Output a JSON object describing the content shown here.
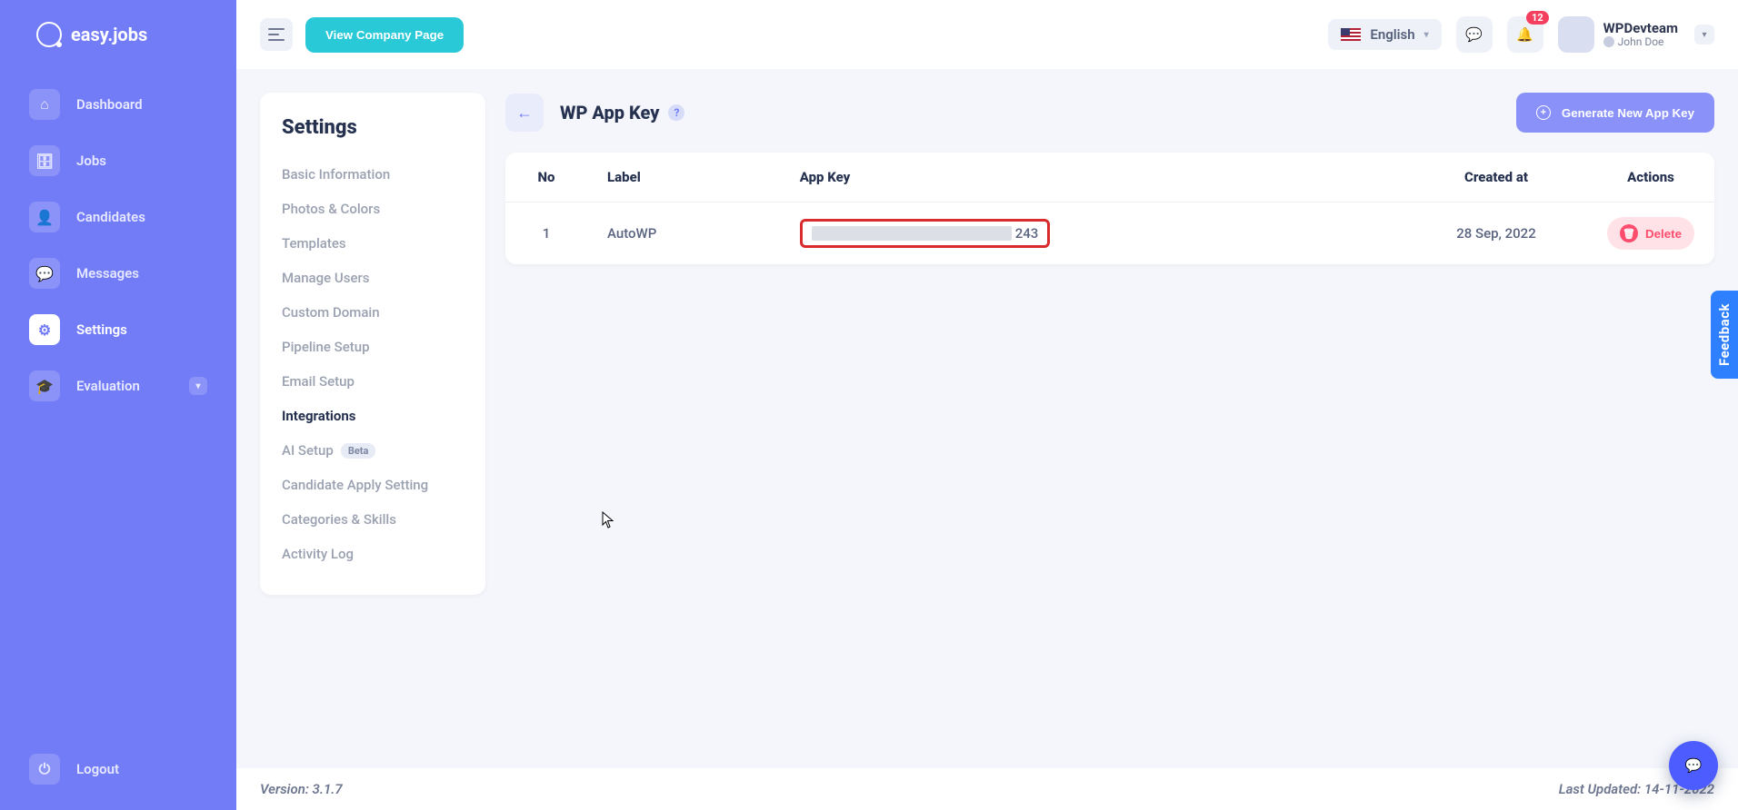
{
  "brand": "easy.jobs",
  "topbar": {
    "view_company": "View Company Page",
    "language": "English",
    "badge": "12",
    "company": "WPDevteam",
    "user": "John Doe"
  },
  "sidebar": {
    "items": [
      {
        "icon": "home",
        "label": "Dashboard"
      },
      {
        "icon": "briefcase",
        "label": "Jobs"
      },
      {
        "icon": "user",
        "label": "Candidates"
      },
      {
        "icon": "chat",
        "label": "Messages"
      },
      {
        "icon": "gear",
        "label": "Settings"
      },
      {
        "icon": "cap",
        "label": "Evaluation"
      }
    ],
    "logout": "Logout"
  },
  "settings": {
    "title": "Settings",
    "items": [
      "Basic Information",
      "Photos & Colors",
      "Templates",
      "Manage Users",
      "Custom Domain",
      "Pipeline Setup",
      "Email Setup",
      "Integrations",
      "AI Setup",
      "Candidate Apply Setting",
      "Categories & Skills",
      "Activity Log"
    ],
    "beta": "Beta"
  },
  "page": {
    "title": "WP App Key",
    "generate": "Generate New App Key",
    "columns": [
      "No",
      "Label",
      "App Key",
      "Created at",
      "Actions"
    ],
    "rows": [
      {
        "no": "1",
        "label": "AutoWP",
        "key_tail": "243",
        "created": "28 Sep, 2022",
        "delete": "Delete"
      }
    ]
  },
  "footer": {
    "version": "Version: 3.1.7",
    "updated": "Last Updated: 14-11-2022"
  },
  "feedback": "Feedback"
}
